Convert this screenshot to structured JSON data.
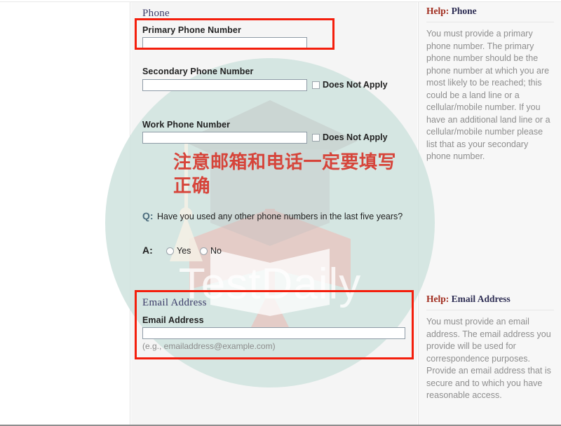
{
  "phone_section": {
    "heading": "Phone",
    "primary": {
      "label": "Primary Phone Number",
      "value": "",
      "placeholder": ""
    },
    "secondary": {
      "label": "Secondary Phone Number",
      "value": "",
      "placeholder": "",
      "does_not_apply_label": "Does Not Apply",
      "does_not_apply_checked": false
    },
    "work": {
      "label": "Work Phone Number",
      "value": "",
      "placeholder": "",
      "does_not_apply_label": "Does Not Apply",
      "does_not_apply_checked": false
    },
    "question": {
      "marker": "Q:",
      "text": "Have you used any other phone numbers in the last five years?",
      "answer_marker": "A:",
      "options": [
        {
          "label": "Yes",
          "selected": false
        },
        {
          "label": "No",
          "selected": false
        }
      ]
    }
  },
  "email_section": {
    "heading": "Email Address",
    "field": {
      "label": "Email Address",
      "value": "",
      "placeholder": ""
    },
    "hint": "(e.g., emailaddress@example.com)"
  },
  "help_phone": {
    "prefix": "Help:",
    "title": "Phone",
    "body": "You must provide a primary phone number. The primary phone number should be the phone number at which you are most likely to be reached; this could be a land line or a cellular/mobile number. If you have an additional land line or a cellular/mobile number please list that as your secondary phone number."
  },
  "help_email": {
    "prefix": "Help:",
    "title": "Email Address",
    "body": "You must provide an email address.  The email address you provide will be used for correspondence purposes.  Provide an email address that is secure and to which you have reasonable access."
  },
  "annotation": {
    "chinese_note": "注意邮箱和电话一定要填写正确",
    "color": "#d6443a"
  },
  "watermark": {
    "brand_text": "TestDaily",
    "circle_color": "#cfe3de",
    "cap_color": "#c9c9c9",
    "book_color": "#f2b7b2"
  },
  "highlight_boxes": {
    "color": "#f41e0c",
    "labels": [
      "primary-phone-highlight",
      "email-address-highlight"
    ]
  }
}
